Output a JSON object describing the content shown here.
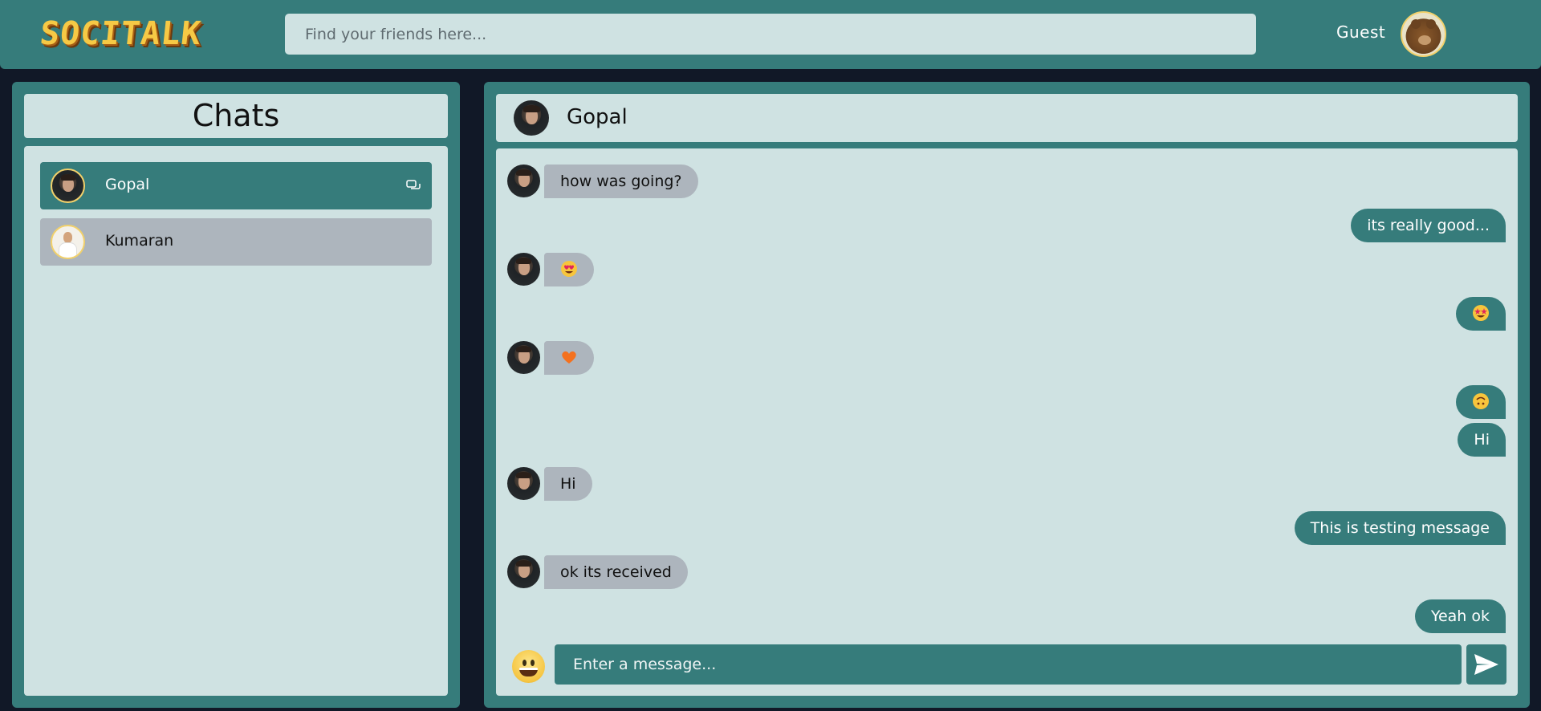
{
  "app": {
    "logo_text": "SOCITALK",
    "search": {
      "placeholder": "Find your friends here..."
    },
    "user": {
      "name": "Guest",
      "avatar_icon": "bear-avatar"
    }
  },
  "sidebar": {
    "title": "Chats",
    "chats": [
      {
        "name": "Gopal",
        "active": true,
        "icon": "chat-bubbles-icon"
      },
      {
        "name": "Kumaran",
        "active": false
      }
    ]
  },
  "conversation": {
    "contact_name": "Gopal",
    "messages": [
      {
        "dir": "in",
        "text": "how was going?"
      },
      {
        "dir": "out",
        "text": "its really good..."
      },
      {
        "dir": "in",
        "text": "",
        "emoji": "heart-eyes-emoji"
      },
      {
        "dir": "out",
        "text": "",
        "emoji": "star-struck-emoji"
      },
      {
        "dir": "in",
        "text": "",
        "emoji": "orange-heart-emoji"
      },
      {
        "dir": "out",
        "text": "",
        "emoji": "upside-down-face-emoji"
      },
      {
        "dir": "out",
        "text": "Hi"
      },
      {
        "dir": "in",
        "text": "Hi"
      },
      {
        "dir": "out",
        "text": "This is testing message"
      },
      {
        "dir": "in",
        "text": "ok its received"
      },
      {
        "dir": "out",
        "text": "Yeah ok"
      }
    ],
    "composer": {
      "placeholder": "Enter a message..."
    }
  },
  "colors": {
    "primary": "#367c7b",
    "panel": "#cfe2e2",
    "background": "#111827",
    "incoming_bubble": "#adb5bd"
  }
}
